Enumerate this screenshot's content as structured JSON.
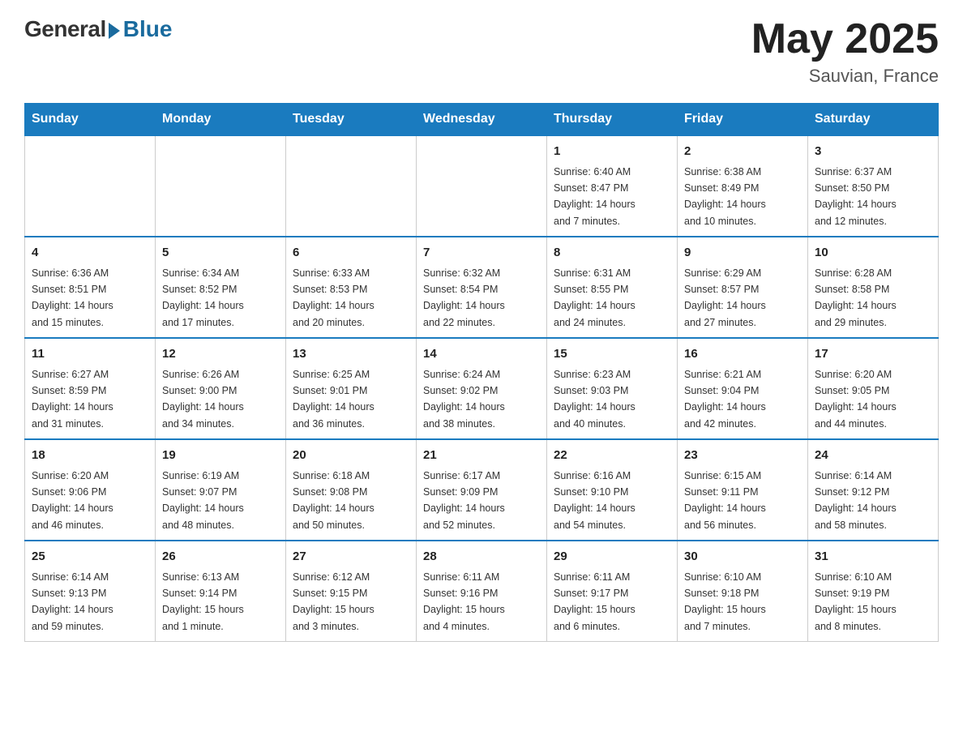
{
  "header": {
    "logo": {
      "general": "General",
      "blue": "Blue"
    },
    "month_year": "May 2025",
    "location": "Sauvian, France"
  },
  "days_of_week": [
    "Sunday",
    "Monday",
    "Tuesday",
    "Wednesday",
    "Thursday",
    "Friday",
    "Saturday"
  ],
  "weeks": [
    {
      "cells": [
        {
          "day": "",
          "info": ""
        },
        {
          "day": "",
          "info": ""
        },
        {
          "day": "",
          "info": ""
        },
        {
          "day": "",
          "info": ""
        },
        {
          "day": "1",
          "info": "Sunrise: 6:40 AM\nSunset: 8:47 PM\nDaylight: 14 hours\nand 7 minutes."
        },
        {
          "day": "2",
          "info": "Sunrise: 6:38 AM\nSunset: 8:49 PM\nDaylight: 14 hours\nand 10 minutes."
        },
        {
          "day": "3",
          "info": "Sunrise: 6:37 AM\nSunset: 8:50 PM\nDaylight: 14 hours\nand 12 minutes."
        }
      ]
    },
    {
      "cells": [
        {
          "day": "4",
          "info": "Sunrise: 6:36 AM\nSunset: 8:51 PM\nDaylight: 14 hours\nand 15 minutes."
        },
        {
          "day": "5",
          "info": "Sunrise: 6:34 AM\nSunset: 8:52 PM\nDaylight: 14 hours\nand 17 minutes."
        },
        {
          "day": "6",
          "info": "Sunrise: 6:33 AM\nSunset: 8:53 PM\nDaylight: 14 hours\nand 20 minutes."
        },
        {
          "day": "7",
          "info": "Sunrise: 6:32 AM\nSunset: 8:54 PM\nDaylight: 14 hours\nand 22 minutes."
        },
        {
          "day": "8",
          "info": "Sunrise: 6:31 AM\nSunset: 8:55 PM\nDaylight: 14 hours\nand 24 minutes."
        },
        {
          "day": "9",
          "info": "Sunrise: 6:29 AM\nSunset: 8:57 PM\nDaylight: 14 hours\nand 27 minutes."
        },
        {
          "day": "10",
          "info": "Sunrise: 6:28 AM\nSunset: 8:58 PM\nDaylight: 14 hours\nand 29 minutes."
        }
      ]
    },
    {
      "cells": [
        {
          "day": "11",
          "info": "Sunrise: 6:27 AM\nSunset: 8:59 PM\nDaylight: 14 hours\nand 31 minutes."
        },
        {
          "day": "12",
          "info": "Sunrise: 6:26 AM\nSunset: 9:00 PM\nDaylight: 14 hours\nand 34 minutes."
        },
        {
          "day": "13",
          "info": "Sunrise: 6:25 AM\nSunset: 9:01 PM\nDaylight: 14 hours\nand 36 minutes."
        },
        {
          "day": "14",
          "info": "Sunrise: 6:24 AM\nSunset: 9:02 PM\nDaylight: 14 hours\nand 38 minutes."
        },
        {
          "day": "15",
          "info": "Sunrise: 6:23 AM\nSunset: 9:03 PM\nDaylight: 14 hours\nand 40 minutes."
        },
        {
          "day": "16",
          "info": "Sunrise: 6:21 AM\nSunset: 9:04 PM\nDaylight: 14 hours\nand 42 minutes."
        },
        {
          "day": "17",
          "info": "Sunrise: 6:20 AM\nSunset: 9:05 PM\nDaylight: 14 hours\nand 44 minutes."
        }
      ]
    },
    {
      "cells": [
        {
          "day": "18",
          "info": "Sunrise: 6:20 AM\nSunset: 9:06 PM\nDaylight: 14 hours\nand 46 minutes."
        },
        {
          "day": "19",
          "info": "Sunrise: 6:19 AM\nSunset: 9:07 PM\nDaylight: 14 hours\nand 48 minutes."
        },
        {
          "day": "20",
          "info": "Sunrise: 6:18 AM\nSunset: 9:08 PM\nDaylight: 14 hours\nand 50 minutes."
        },
        {
          "day": "21",
          "info": "Sunrise: 6:17 AM\nSunset: 9:09 PM\nDaylight: 14 hours\nand 52 minutes."
        },
        {
          "day": "22",
          "info": "Sunrise: 6:16 AM\nSunset: 9:10 PM\nDaylight: 14 hours\nand 54 minutes."
        },
        {
          "day": "23",
          "info": "Sunrise: 6:15 AM\nSunset: 9:11 PM\nDaylight: 14 hours\nand 56 minutes."
        },
        {
          "day": "24",
          "info": "Sunrise: 6:14 AM\nSunset: 9:12 PM\nDaylight: 14 hours\nand 58 minutes."
        }
      ]
    },
    {
      "cells": [
        {
          "day": "25",
          "info": "Sunrise: 6:14 AM\nSunset: 9:13 PM\nDaylight: 14 hours\nand 59 minutes."
        },
        {
          "day": "26",
          "info": "Sunrise: 6:13 AM\nSunset: 9:14 PM\nDaylight: 15 hours\nand 1 minute."
        },
        {
          "day": "27",
          "info": "Sunrise: 6:12 AM\nSunset: 9:15 PM\nDaylight: 15 hours\nand 3 minutes."
        },
        {
          "day": "28",
          "info": "Sunrise: 6:11 AM\nSunset: 9:16 PM\nDaylight: 15 hours\nand 4 minutes."
        },
        {
          "day": "29",
          "info": "Sunrise: 6:11 AM\nSunset: 9:17 PM\nDaylight: 15 hours\nand 6 minutes."
        },
        {
          "day": "30",
          "info": "Sunrise: 6:10 AM\nSunset: 9:18 PM\nDaylight: 15 hours\nand 7 minutes."
        },
        {
          "day": "31",
          "info": "Sunrise: 6:10 AM\nSunset: 9:19 PM\nDaylight: 15 hours\nand 8 minutes."
        }
      ]
    }
  ]
}
